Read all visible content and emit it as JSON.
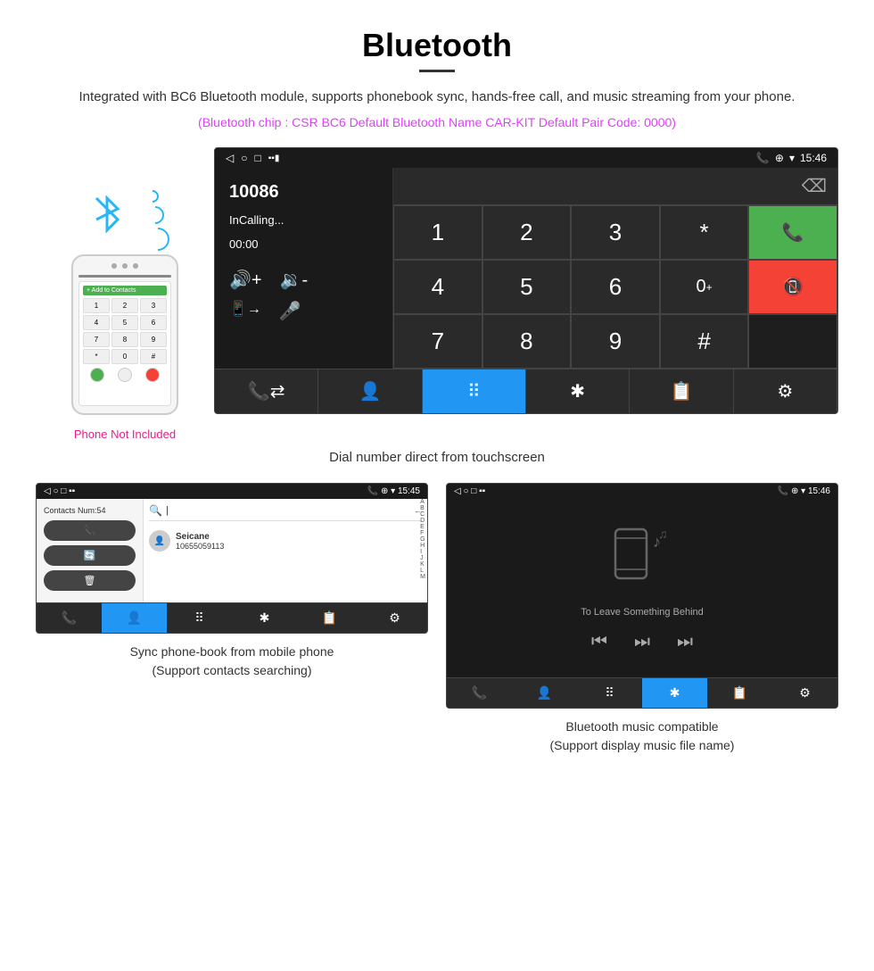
{
  "header": {
    "title": "Bluetooth",
    "description": "Integrated with BC6 Bluetooth module, supports phonebook sync, hands-free call, and music streaming from your phone.",
    "bluetooth_info": "(Bluetooth chip : CSR BC6    Default Bluetooth Name CAR-KIT    Default Pair Code: 0000)"
  },
  "phone_side": {
    "not_included": "Phone Not Included"
  },
  "car_screen": {
    "status_bar": {
      "time": "15:46",
      "left_icons": [
        "◁",
        "○",
        "□"
      ],
      "right_icons": [
        "📞",
        "⊕",
        "▾"
      ]
    },
    "dial": {
      "number": "10086",
      "status": "InCalling...",
      "timer": "00:00"
    },
    "keypad": {
      "keys": [
        "1",
        "2",
        "3",
        "*",
        "4",
        "5",
        "6",
        "0+",
        "7",
        "8",
        "9",
        "#"
      ]
    }
  },
  "main_caption": "Dial number direct from touchscreen",
  "contacts_screen": {
    "status_time": "15:45",
    "contacts_num": "Contacts Num:54",
    "contact_name": "Seicane",
    "contact_number": "10655059113",
    "alpha": [
      "A",
      "B",
      "C",
      "D",
      "E",
      "F",
      "G",
      "H",
      "I",
      "J",
      "K",
      "L",
      "M"
    ]
  },
  "music_screen": {
    "status_time": "15:46",
    "song_title": "To Leave Something Behind"
  },
  "bottom_captions": {
    "left": {
      "line1": "Sync phone-book from mobile phone",
      "line2": "(Support contacts searching)"
    },
    "right": {
      "line1": "Bluetooth music compatible",
      "line2": "(Support display music file name)"
    }
  }
}
